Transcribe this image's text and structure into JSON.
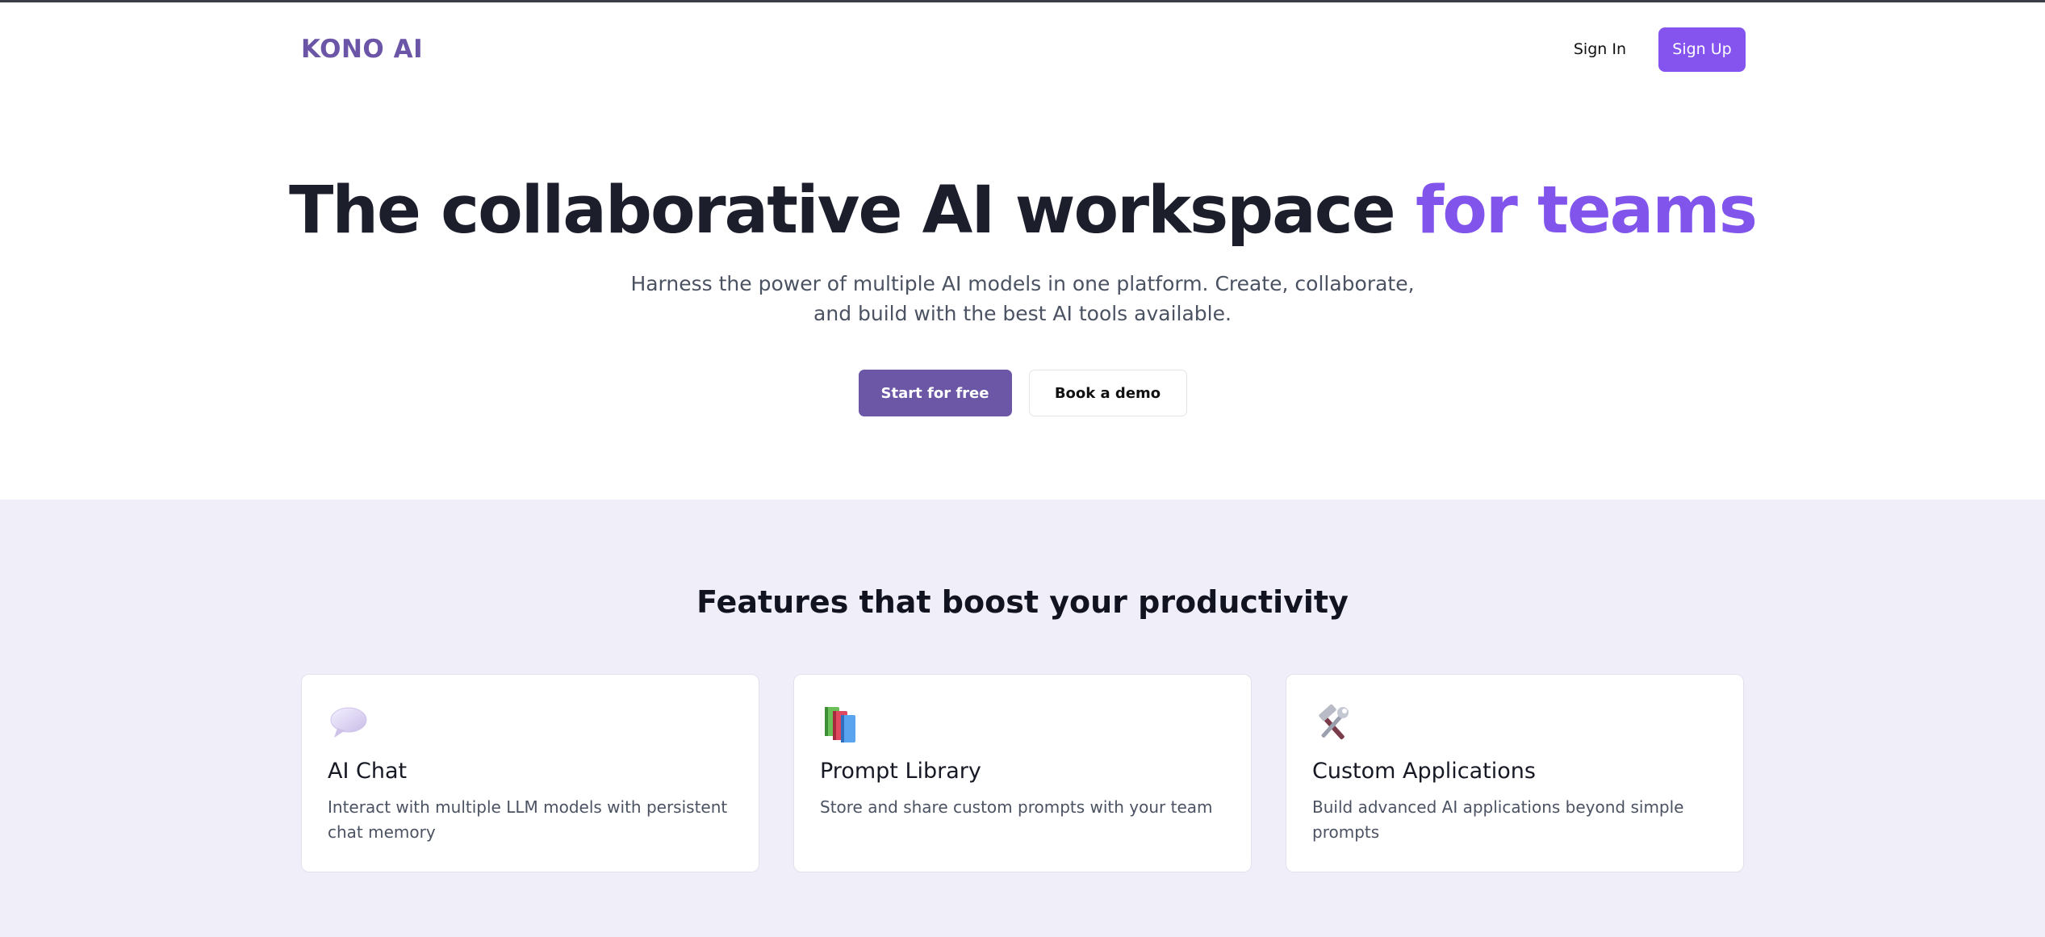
{
  "header": {
    "logo": "KONO AI",
    "sign_in": "Sign In",
    "sign_up": "Sign Up"
  },
  "hero": {
    "title_main": "The collaborative AI workspace ",
    "title_accent": "for teams",
    "subtitle": "Harness the power of multiple AI models in one platform. Create, collaborate, and build with the best AI tools available.",
    "primary_cta": "Start for free",
    "secondary_cta": "Book a demo"
  },
  "features": {
    "heading": "Features that boost your productivity",
    "cards": [
      {
        "icon": "speech-bubble-icon",
        "title": "AI Chat",
        "description": "Interact with multiple LLM models with persistent chat memory"
      },
      {
        "icon": "books-icon",
        "title": "Prompt Library",
        "description": "Store and share custom prompts with your team"
      },
      {
        "icon": "hammer-wrench-icon",
        "title": "Custom Applications",
        "description": "Build advanced AI applications beyond simple prompts"
      }
    ]
  },
  "colors": {
    "brand": "#6a55a6",
    "accent": "#8154ec",
    "signup_bg": "#8554ee",
    "features_bg": "#f0eef9"
  }
}
